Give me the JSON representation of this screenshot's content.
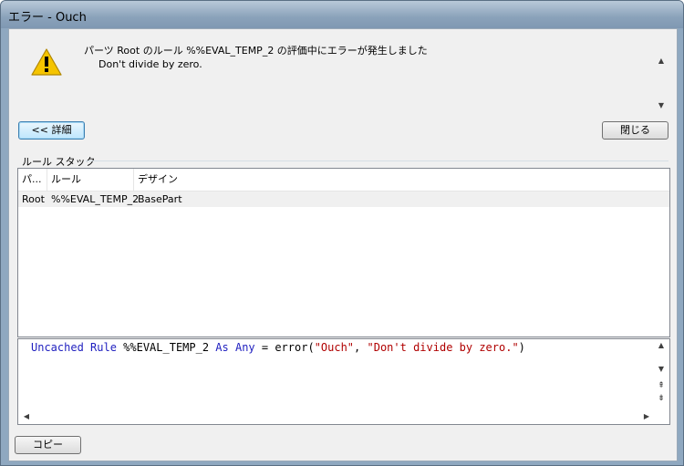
{
  "window": {
    "title": "エラー - Ouch"
  },
  "message": {
    "line1": "パーツ Root のルール %%EVAL_TEMP_2 の評価中にエラーが発生しました",
    "line2": "Don't divide by zero."
  },
  "buttons": {
    "details": "<< 詳細",
    "close": "閉じる",
    "copy": "コピー"
  },
  "rule_stack": {
    "label": "ルール スタック",
    "columns": [
      "パ...",
      "ルール",
      "デザイン"
    ],
    "rows": [
      {
        "part": "Root",
        "rule": "%%EVAL_TEMP_2",
        "design": "BasePart"
      }
    ]
  },
  "code": {
    "kw1": "Uncached Rule",
    "name": " %%EVAL_TEMP_2 ",
    "kw2": "As Any",
    "op": " = error(",
    "str1": "\"Ouch\"",
    "comma": ", ",
    "str2": "\"Don't divide by zero.\"",
    "close": ")"
  },
  "colors": {
    "keyword": "#1f1fbf",
    "string": "#b00000",
    "warning": "#f5c400"
  }
}
